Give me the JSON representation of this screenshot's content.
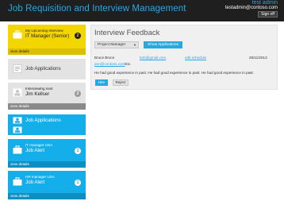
{
  "header": {
    "title": "Job Requisition and Interview Management",
    "user_name": "test admin",
    "user_email": "testadmin@contoso.com",
    "signoff_label": "Sign off"
  },
  "tiles": {
    "upcoming": {
      "subtitle": "My Upcoming Interview",
      "title": "IT Manager (Senior)",
      "badge": "2",
      "footer": "view details"
    },
    "job_applications_gray": {
      "title": "Job Applications"
    },
    "interviewing": {
      "subtitle": "Interviewing next",
      "title": "Jim Kellser",
      "badge": "2",
      "footer": "view details"
    },
    "job_applications_blue": {
      "title": "Job Applications"
    },
    "alert1": {
      "subtitle": "IT manager USA",
      "title": "Job Alert",
      "badge": "1",
      "footer": "view details"
    },
    "alert2": {
      "subtitle": "HR manager USA",
      "title": "Job Alert",
      "badge": "1",
      "footer": "view details"
    }
  },
  "feedback": {
    "title": "Interview Feedback",
    "select_value": "Project Manager",
    "show_button": "Show Applications",
    "candidate_name": "Bruce Bruce",
    "candidate_email": "bob@gmail.com",
    "edit_schedule": "edit schedule",
    "date": "28/11/2013",
    "interviewer_email": "ann@contoso.com",
    "interviewer_suffix": "Etc.",
    "feedback_text": "He had good experience in past. He had good experience in past. He had good experience in past.",
    "hire_label": "Hire",
    "reject_label": "Reject"
  },
  "colors": {
    "accent": "#29a8e0",
    "yellow": "#f3d500",
    "tile_blue": "#14aeea",
    "tile_gray": "#e3e3e3",
    "topbar": "#1f1f1f"
  },
  "icons": [
    "briefcase-icon",
    "document-icon",
    "person-icon",
    "chevron-right-icon",
    "badge-icon"
  ]
}
